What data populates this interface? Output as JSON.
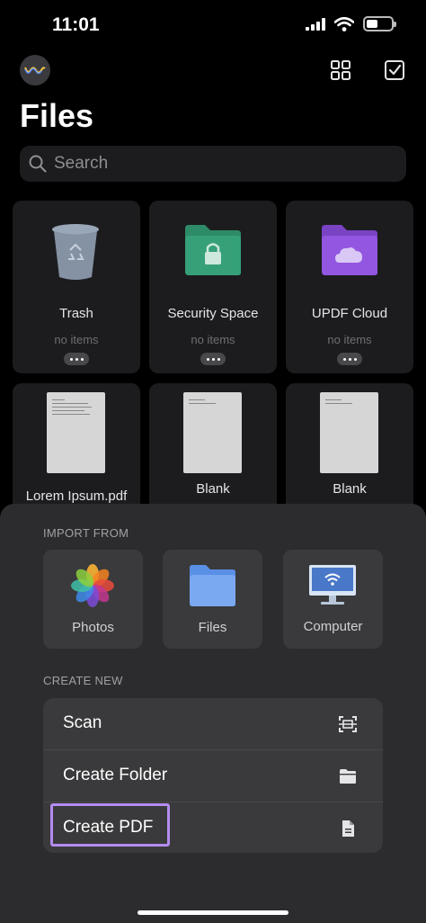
{
  "status_bar": {
    "time": "11:01"
  },
  "header": {
    "title": "Files"
  },
  "search": {
    "placeholder": "Search"
  },
  "folders": [
    {
      "name": "Trash",
      "meta": "no items",
      "icon": "trash-icon"
    },
    {
      "name": "Security Space",
      "meta": "no items",
      "icon": "lock-folder-icon",
      "color": "#2e8b67"
    },
    {
      "name": "UPDF Cloud",
      "meta": "no items",
      "icon": "cloud-folder-icon",
      "color": "#8a4fd6"
    }
  ],
  "documents": [
    {
      "name": "Lorem Ipsum.pdf"
    },
    {
      "name": "Blank"
    },
    {
      "name": "Blank"
    }
  ],
  "import_from": {
    "label": "IMPORT FROM",
    "items": [
      {
        "label": "Photos",
        "icon": "photos-icon"
      },
      {
        "label": "Files",
        "icon": "files-folder-icon"
      },
      {
        "label": "Computer",
        "icon": "computer-wifi-icon"
      }
    ]
  },
  "create_new": {
    "label": "CREATE NEW",
    "items": [
      {
        "label": "Scan",
        "icon": "scan-icon"
      },
      {
        "label": "Create Folder",
        "icon": "folder-icon"
      },
      {
        "label": "Create PDF",
        "icon": "document-icon"
      }
    ]
  },
  "colors": {
    "accent_highlight": "#b48cf0",
    "sheet_bg": "#2c2c2e",
    "card_bg": "#3a3a3c"
  }
}
